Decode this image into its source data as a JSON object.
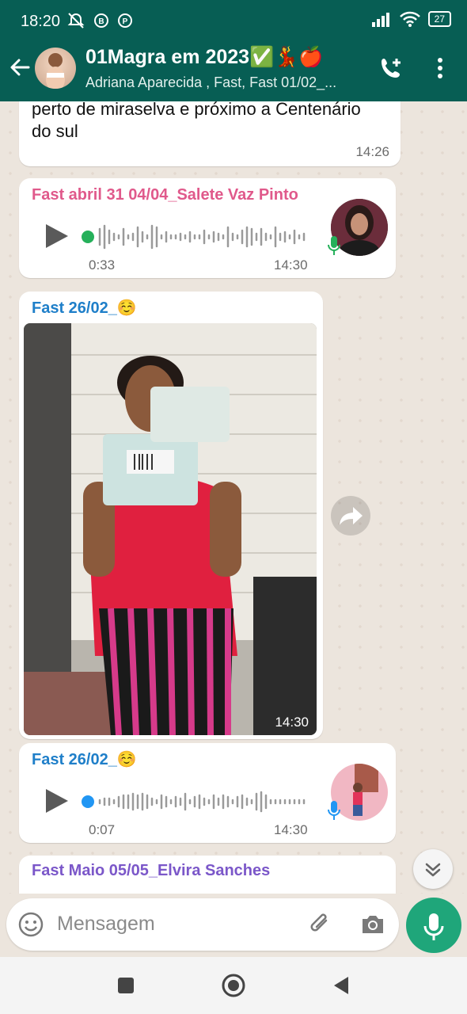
{
  "status_bar": {
    "time": "18:20",
    "battery": "27"
  },
  "header": {
    "title": "01Magra em 2023",
    "title_emojis": "✅💃🍎",
    "subtitle": "Adriana Aparecida , Fast, Fast 01/02_..."
  },
  "messages": [
    {
      "type": "text",
      "text": "Boa tarde eu moro na fazenda três coração perto de miraselva e próximo a Centenário do sul",
      "time": "14:26"
    },
    {
      "type": "voice",
      "sender": "Fast abril 31 04/04_Salete Vaz Pinto",
      "sender_color": "#e0598b",
      "duration": "0:33",
      "time": "14:30"
    },
    {
      "type": "image",
      "sender": "Fast 26/02_☺️",
      "sender_color": "#1f7fc9",
      "time": "14:30"
    },
    {
      "type": "voice",
      "sender": "Fast 26/02_☺️",
      "sender_color": "#1f7fc9",
      "duration": "0:07",
      "time": "14:30"
    },
    {
      "type": "partial",
      "sender": "Fast Maio 05/05_Elvira Sanches",
      "sender_color": "#7b57c9"
    }
  ],
  "composer": {
    "placeholder": "Mensagem"
  },
  "colors": {
    "header": "#075e54",
    "accent": "#1fa67a",
    "played_dot": "#25b05a",
    "unplayed_dot": "#2196f3"
  }
}
